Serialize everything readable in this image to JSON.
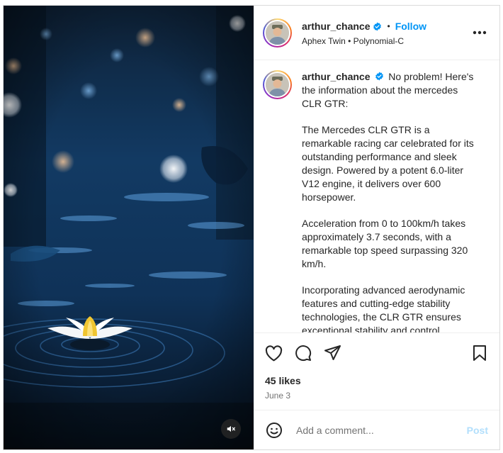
{
  "header": {
    "username": "arthur_chance",
    "separator": "•",
    "follow_label": "Follow",
    "audio": "Aphex Twin • Polynomial-C",
    "more_icon": "more-horizontal-icon"
  },
  "caption": {
    "username": "arthur_chance",
    "paragraphs": [
      "No problem! Here's the information about the mercedes CLR GTR:",
      "The Mercedes CLR GTR is a remarkable racing car celebrated for its outstanding performance and sleek design. Powered by a potent 6.0-liter V12 engine, it delivers over 600 horsepower.",
      "Acceleration from 0 to 100km/h takes approximately 3.7 seconds, with a remarkable top speed surpassing 320 km/h.",
      "Incorporating advanced aerodynamic features and cutting-edge stability technologies, the CLR GTR ensures exceptional stability and control"
    ]
  },
  "actions": {
    "like_icon": "heart-icon",
    "comment_icon": "comment-icon",
    "share_icon": "paper-plane-icon",
    "save_icon": "bookmark-icon"
  },
  "likes": "45 likes",
  "date": "June 3",
  "comment": {
    "placeholder": "Add a comment...",
    "post_label": "Post",
    "emoji_icon": "emoji-smile-icon"
  },
  "media": {
    "mute_icon": "speaker-muted-icon"
  },
  "colors": {
    "accent": "#0095f6",
    "post_disabled": "#b2dffc",
    "verified": "#0095f6",
    "muted_text": "#737373"
  }
}
